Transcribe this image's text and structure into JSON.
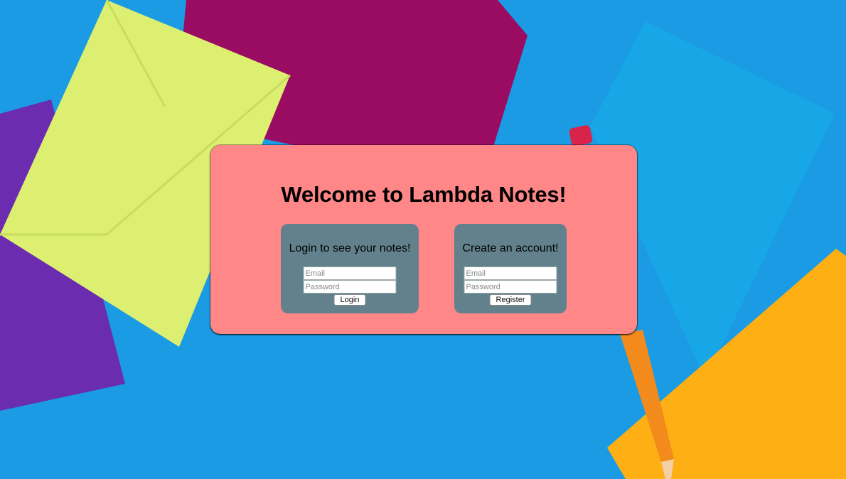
{
  "welcome": {
    "title": "Welcome to Lambda Notes!"
  },
  "login": {
    "heading": "Login to see your notes!",
    "email_placeholder": "Email",
    "password_placeholder": "Password",
    "button_label": "Login"
  },
  "register": {
    "heading": "Create an account!",
    "email_placeholder": "Email",
    "password_placeholder": "Password",
    "button_label": "Register"
  },
  "colors": {
    "card_background": "#ff8787",
    "panel_background": "#62818d",
    "page_background": "#1a9be3"
  }
}
